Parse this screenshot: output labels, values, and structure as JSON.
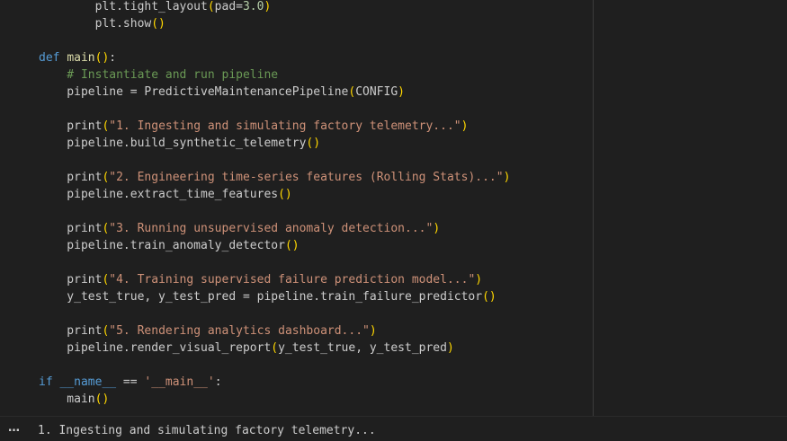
{
  "colors": {
    "background": "#1f1f1f",
    "default": "#cccccc",
    "keyword": "#569cd6",
    "function": "#dcdcaa",
    "string": "#ce9178",
    "comment": "#6a9955",
    "number": "#b5cea8",
    "paren": "#ffd700",
    "variable": "#9cdcfe",
    "class": "#4ec9b0"
  },
  "code_lines": [
    [
      {
        "t": "        plt.tight_layout",
        "c": "default"
      },
      {
        "t": "(",
        "c": "paren"
      },
      {
        "t": "pad=",
        "c": "default"
      },
      {
        "t": "3.0",
        "c": "number"
      },
      {
        "t": ")",
        "c": "paren"
      }
    ],
    [
      {
        "t": "        plt.show",
        "c": "default"
      },
      {
        "t": "()",
        "c": "paren"
      }
    ],
    [
      {
        "t": "",
        "c": "default"
      }
    ],
    [
      {
        "t": "def",
        "c": "keyword"
      },
      {
        "t": " ",
        "c": "default"
      },
      {
        "t": "main",
        "c": "function"
      },
      {
        "t": "()",
        "c": "paren"
      },
      {
        "t": ":",
        "c": "default"
      }
    ],
    [
      {
        "t": "    # Instantiate and run pipeline",
        "c": "comment"
      }
    ],
    [
      {
        "t": "    pipeline = PredictiveMaintenancePipeline",
        "c": "default"
      },
      {
        "t": "(",
        "c": "paren"
      },
      {
        "t": "CONFIG",
        "c": "default"
      },
      {
        "t": ")",
        "c": "paren"
      }
    ],
    [
      {
        "t": "",
        "c": "default"
      }
    ],
    [
      {
        "t": "    print",
        "c": "default"
      },
      {
        "t": "(",
        "c": "paren"
      },
      {
        "t": "\"1. Ingesting and simulating factory telemetry...\"",
        "c": "string"
      },
      {
        "t": ")",
        "c": "paren"
      }
    ],
    [
      {
        "t": "    pipeline.build_synthetic_telemetry",
        "c": "default"
      },
      {
        "t": "()",
        "c": "paren"
      }
    ],
    [
      {
        "t": "",
        "c": "default"
      }
    ],
    [
      {
        "t": "    print",
        "c": "default"
      },
      {
        "t": "(",
        "c": "paren"
      },
      {
        "t": "\"2. Engineering time-series features (Rolling Stats)...\"",
        "c": "string"
      },
      {
        "t": ")",
        "c": "paren"
      }
    ],
    [
      {
        "t": "    pipeline.extract_time_features",
        "c": "default"
      },
      {
        "t": "()",
        "c": "paren"
      }
    ],
    [
      {
        "t": "",
        "c": "default"
      }
    ],
    [
      {
        "t": "    print",
        "c": "default"
      },
      {
        "t": "(",
        "c": "paren"
      },
      {
        "t": "\"3. Running unsupervised anomaly detection...\"",
        "c": "string"
      },
      {
        "t": ")",
        "c": "paren"
      }
    ],
    [
      {
        "t": "    pipeline.train_anomaly_detector",
        "c": "default"
      },
      {
        "t": "()",
        "c": "paren"
      }
    ],
    [
      {
        "t": "",
        "c": "default"
      }
    ],
    [
      {
        "t": "    print",
        "c": "default"
      },
      {
        "t": "(",
        "c": "paren"
      },
      {
        "t": "\"4. Training supervised failure prediction model...\"",
        "c": "string"
      },
      {
        "t": ")",
        "c": "paren"
      }
    ],
    [
      {
        "t": "    y_test_true, y_test_pred = pipeline.train_failure_predictor",
        "c": "default"
      },
      {
        "t": "()",
        "c": "paren"
      }
    ],
    [
      {
        "t": "",
        "c": "default"
      }
    ],
    [
      {
        "t": "    print",
        "c": "default"
      },
      {
        "t": "(",
        "c": "paren"
      },
      {
        "t": "\"5. Rendering analytics dashboard...\"",
        "c": "string"
      },
      {
        "t": ")",
        "c": "paren"
      }
    ],
    [
      {
        "t": "    pipeline.render_visual_report",
        "c": "default"
      },
      {
        "t": "(",
        "c": "paren"
      },
      {
        "t": "y_test_true, y_test_pred",
        "c": "default"
      },
      {
        "t": ")",
        "c": "paren"
      }
    ],
    [
      {
        "t": "",
        "c": "default"
      }
    ],
    [
      {
        "t": "if",
        "c": "keyword"
      },
      {
        "t": " ",
        "c": "default"
      },
      {
        "t": "__name__",
        "c": "keyword"
      },
      {
        "t": " == ",
        "c": "default"
      },
      {
        "t": "'__main__'",
        "c": "string"
      },
      {
        "t": ":",
        "c": "default"
      }
    ],
    [
      {
        "t": "    main",
        "c": "default"
      },
      {
        "t": "()",
        "c": "paren"
      }
    ]
  ],
  "output": {
    "more_icon": "…",
    "text": "1. Ingesting and simulating factory telemetry..."
  }
}
